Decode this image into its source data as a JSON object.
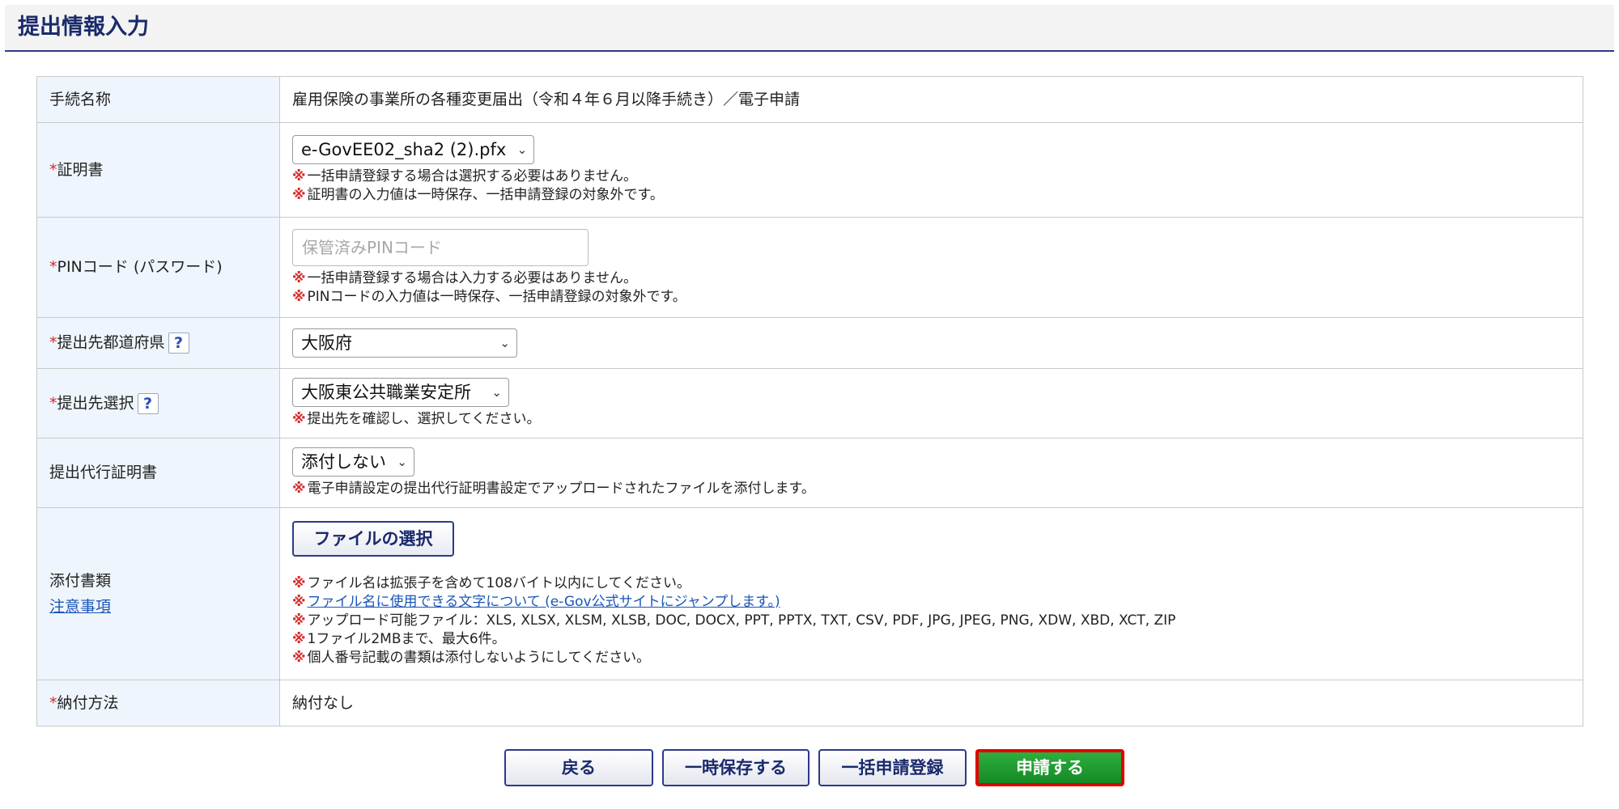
{
  "page": {
    "title": "提出情報入力"
  },
  "required_mark": "*",
  "help_mark": "?",
  "note_mark": "※",
  "form": {
    "procedure": {
      "label": "手続名称",
      "value": "雇用保険の事業所の各種変更届出（令和４年６月以降手続き）／電子申請"
    },
    "certificate": {
      "label": "証明書",
      "selected": "e-GovEE02_sha2 (2).pfx",
      "notes": [
        "一括申請登録する場合は選択する必要はありません。",
        "証明書の入力値は一時保存、一括申請登録の対象外です。"
      ]
    },
    "pin": {
      "label": "PINコード (パスワード)",
      "placeholder": "保管済みPINコード",
      "notes": [
        "一括申請登録する場合は入力する必要はありません。",
        "PINコードの入力値は一時保存、一括申請登録の対象外です。"
      ]
    },
    "prefecture": {
      "label": "提出先都道府県",
      "selected": "大阪府"
    },
    "destination": {
      "label": "提出先選択",
      "selected": "大阪東公共職業安定所",
      "notes": [
        "提出先を確認し、選択してください。"
      ]
    },
    "proxy_cert": {
      "label": "提出代行証明書",
      "selected": "添付しない",
      "notes": [
        "電子申請設定の提出代行証明書設定でアップロードされたファイルを添付します。"
      ]
    },
    "attachments": {
      "label": "添付書類",
      "caution_link": "注意事項",
      "file_button": "ファイルの選択",
      "notes": [
        "ファイル名は拡張子を含めて108バイト以内にしてください。",
        "ファイル名に使用できる文字について (e-Gov公式サイトにジャンプします。)",
        "アップロード可能ファイル：XLS, XLSX, XLSM, XLSB, DOC, DOCX, PPT, PPTX, TXT, CSV, PDF, JPG, JPEG, PNG, XDW, XBD, XCT, ZIP",
        "1ファイル2MBまで、最大6件。",
        "個人番号記載の書類は添付しないようにしてください。"
      ]
    },
    "payment": {
      "label": "納付方法",
      "value": "納付なし"
    }
  },
  "actions": {
    "back": "戻る",
    "save": "一時保存する",
    "batch": "一括申請登録",
    "submit": "申請する"
  }
}
